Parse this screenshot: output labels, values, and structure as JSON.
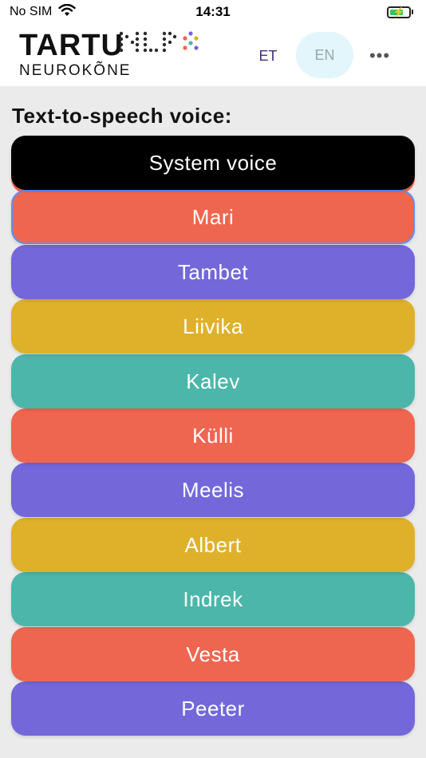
{
  "status_bar": {
    "carrier": "No SIM",
    "time": "14:31"
  },
  "header": {
    "logo_main": "TARTU",
    "logo_sub": "NEUROKÕNE",
    "lang_et": "ET",
    "lang_en": "EN",
    "more": "•••"
  },
  "section_title": "Text-to-speech voice:",
  "voices": [
    {
      "label": "System voice",
      "color": "#000000"
    },
    {
      "label": "Mari",
      "color": "#ef6650",
      "selected": true
    },
    {
      "label": "Tambet",
      "color": "#7367da"
    },
    {
      "label": "Liivika",
      "color": "#dfb12b"
    },
    {
      "label": "Kalev",
      "color": "#4cb6aa"
    },
    {
      "label": "Külli",
      "color": "#ef6650"
    },
    {
      "label": "Meelis",
      "color": "#7367da"
    },
    {
      "label": "Albert",
      "color": "#dfb12b"
    },
    {
      "label": "Indrek",
      "color": "#4cb6aa"
    },
    {
      "label": "Vesta",
      "color": "#ef6650"
    },
    {
      "label": "Peeter",
      "color": "#7367da"
    }
  ]
}
